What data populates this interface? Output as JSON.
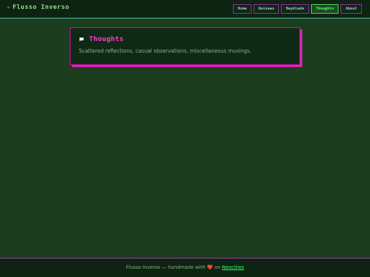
{
  "header": {
    "site_title": "Flusso Inverso",
    "logo_icon": "sparkle-icon"
  },
  "nav": {
    "items": [
      {
        "label": "Home",
        "active": false
      },
      {
        "label": "Reviews",
        "active": false
      },
      {
        "label": "Beyblade",
        "active": false
      },
      {
        "label": "Thoughts",
        "active": true
      },
      {
        "label": "About",
        "active": false
      }
    ]
  },
  "card": {
    "icon": "speech-bubble-icon",
    "title": "Thoughts",
    "description": "Scattered reflections, casual observations, miscellaneous musings."
  },
  "footer": {
    "prefix": "Flusso Inverso — handmade with",
    "heart": "❤️",
    "middle": "on",
    "link_label": "Neocities"
  },
  "colors": {
    "background": "#1d3d1f",
    "accent_magenta": "#e021c0",
    "accent_green": "#3ee65a"
  }
}
